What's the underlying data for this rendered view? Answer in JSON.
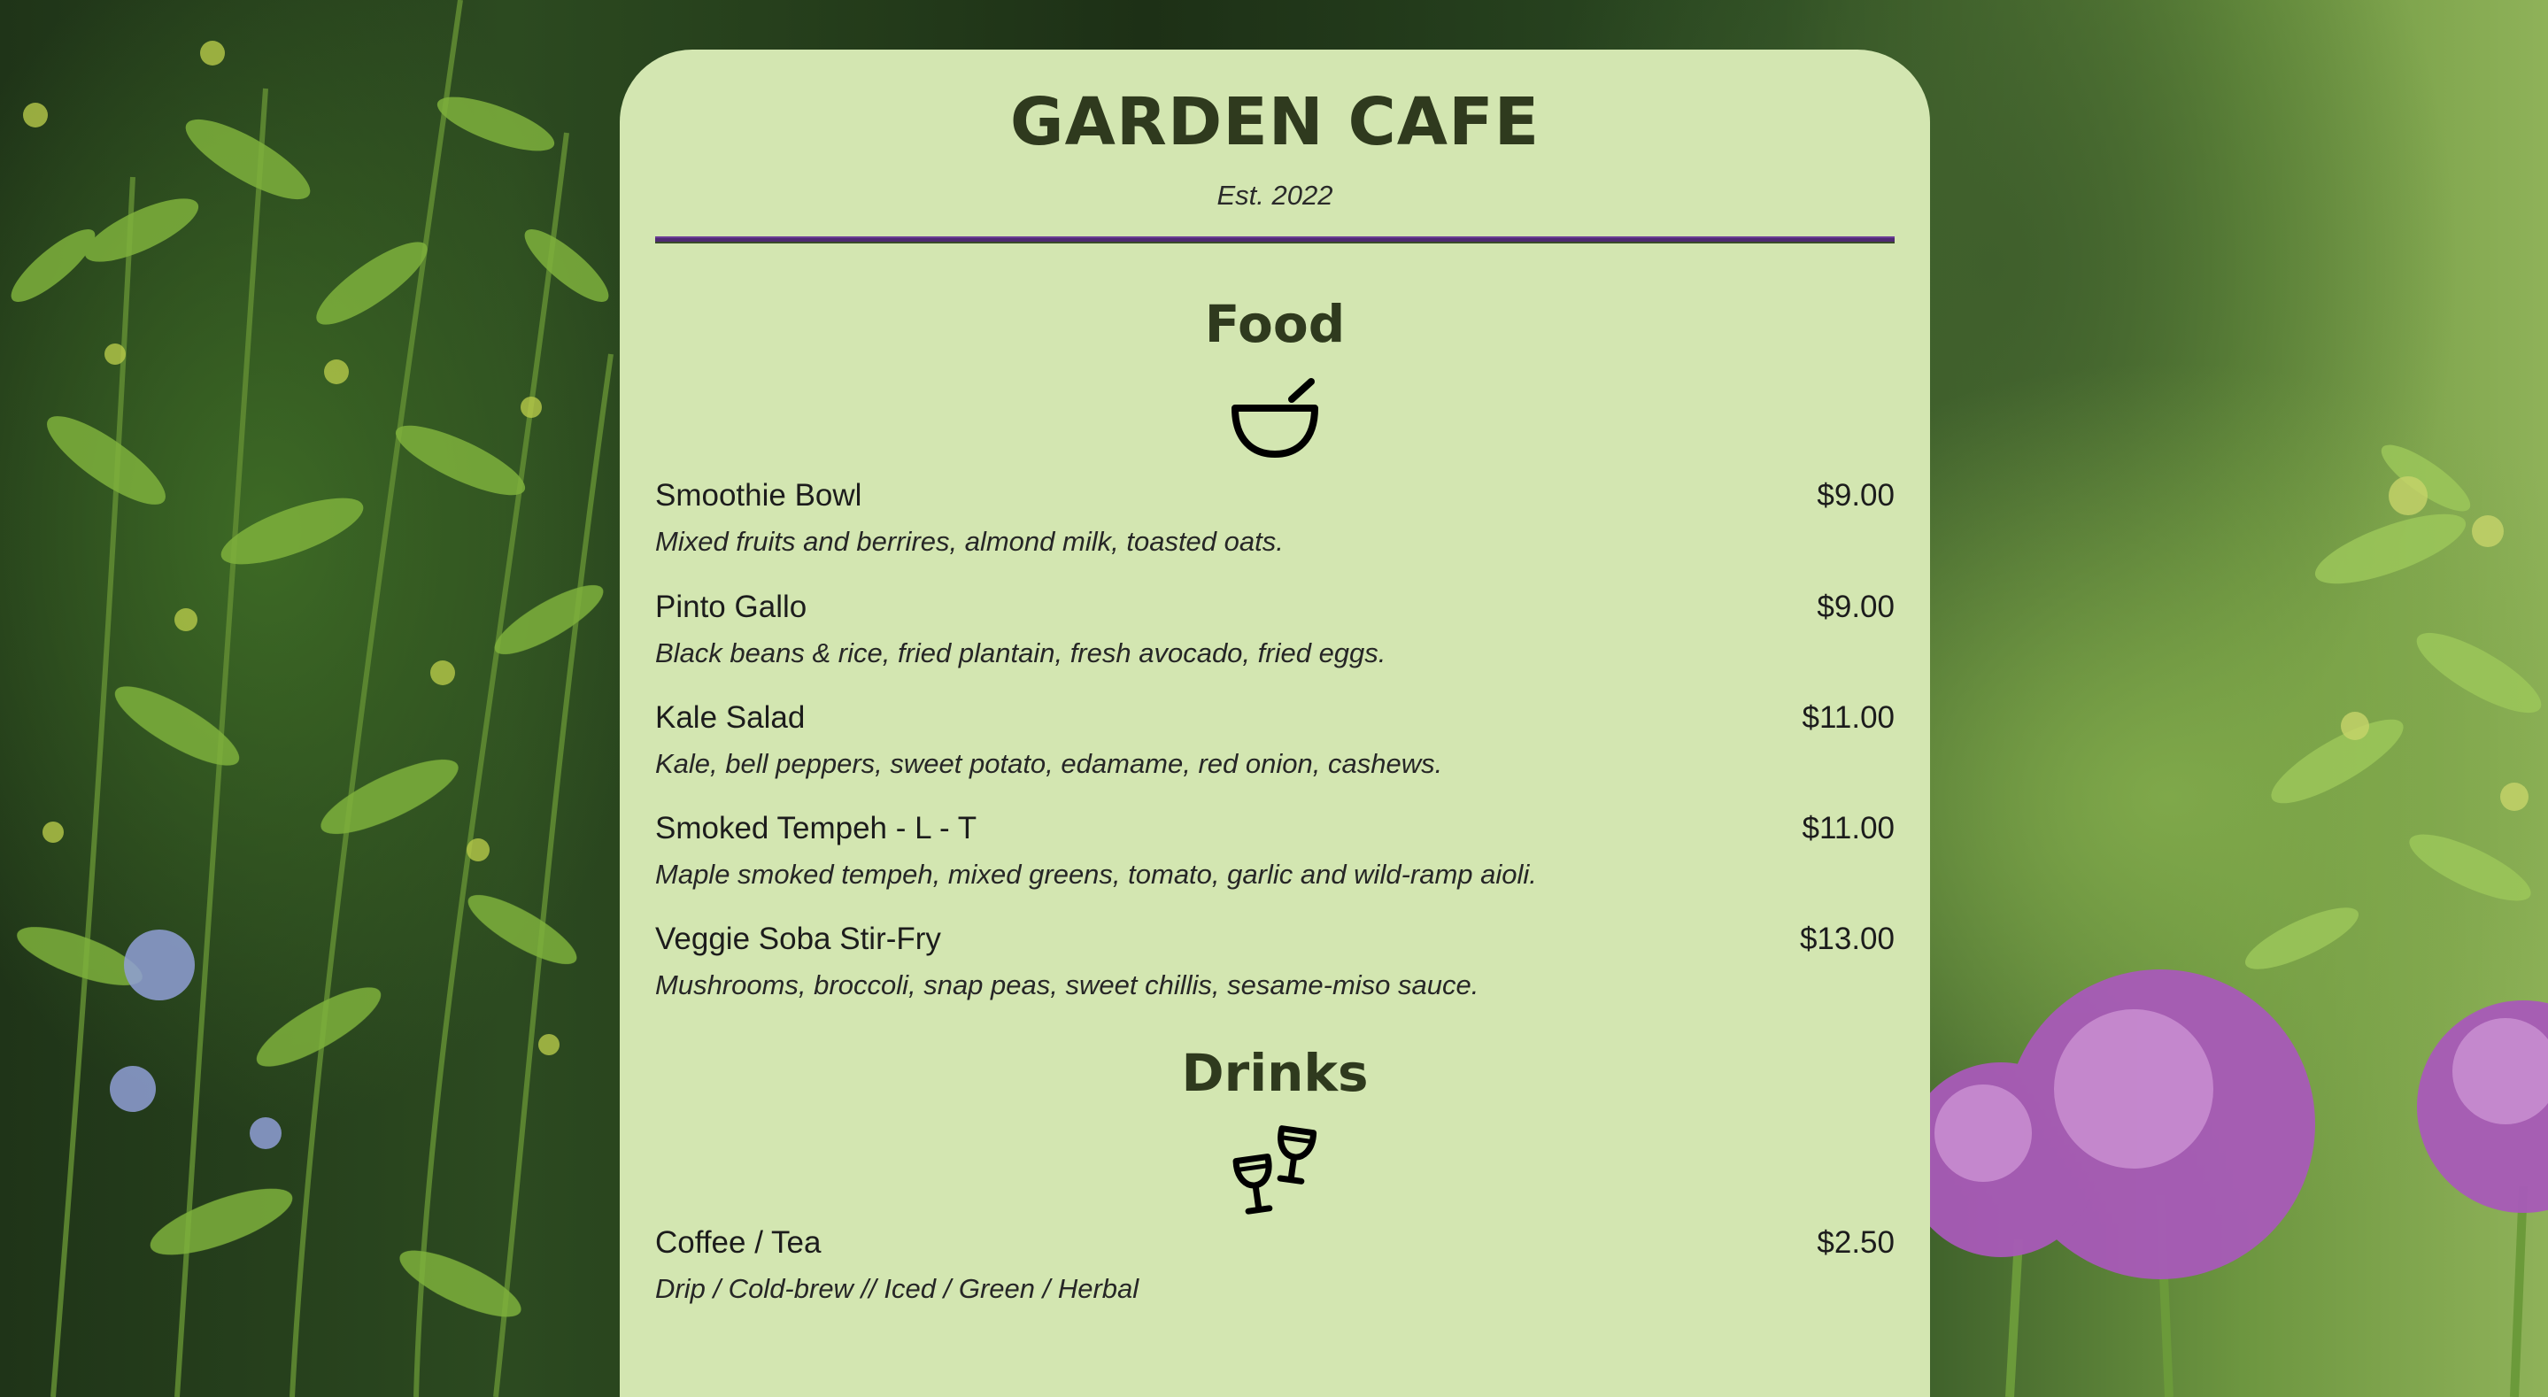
{
  "cafe": {
    "name": "GARDEN CAFE",
    "established": "Est. 2022"
  },
  "sections": [
    {
      "title": "Food",
      "icon": "bowl-icon",
      "items": [
        {
          "name": "Smoothie Bowl",
          "price": "$9.00",
          "description": "Mixed fruits and berrires, almond milk, toasted oats."
        },
        {
          "name": "Pinto Gallo",
          "price": "$9.00",
          "description": "Black beans & rice, fried plantain, fresh avocado, fried eggs."
        },
        {
          "name": "Kale Salad",
          "price": "$11.00",
          "description": "Kale, bell peppers, sweet potato, edamame, red onion, cashews."
        },
        {
          "name": "Smoked Tempeh - L - T",
          "price": "$11.00",
          "description": "Maple smoked tempeh, mixed greens, tomato, garlic and wild-ramp aioli."
        },
        {
          "name": "Veggie Soba Stir-Fry",
          "price": "$13.00",
          "description": "Mushrooms, broccoli, snap peas, sweet chillis, sesame-miso sauce."
        }
      ]
    },
    {
      "title": "Drinks",
      "icon": "wine-glasses-icon",
      "items": [
        {
          "name": "Coffee / Tea",
          "price": "$2.50",
          "description": "Drip / Cold-brew // Iced / Green / Herbal"
        }
      ]
    }
  ],
  "colors": {
    "card": "#d3e6b1",
    "divider": "#4e2a72",
    "heading": "#2f3a1e"
  }
}
